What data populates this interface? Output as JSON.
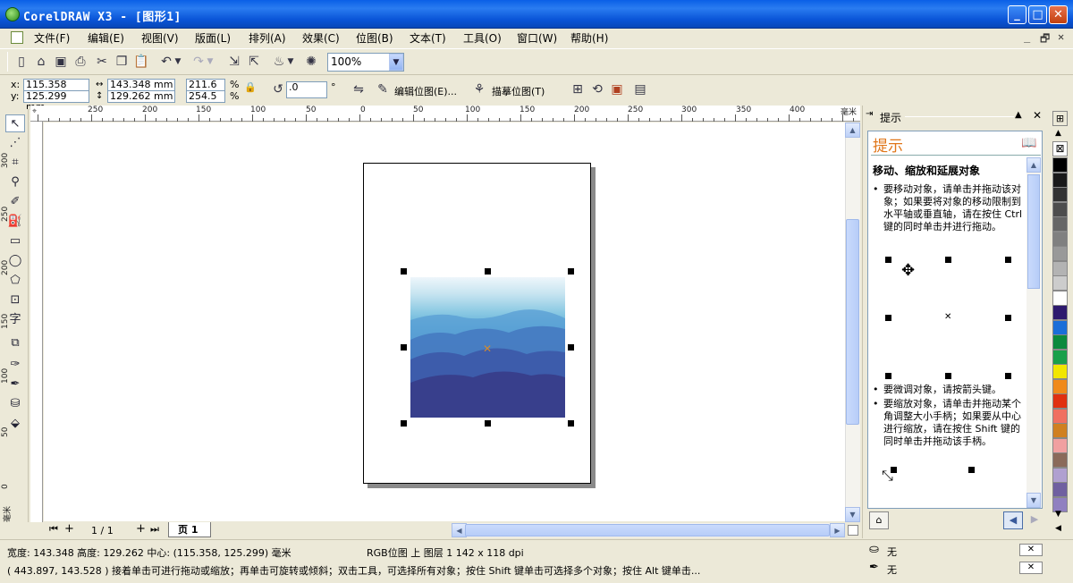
{
  "window": {
    "title": "CorelDRAW X3 - [图形1]",
    "min": "_",
    "max": "□",
    "close": "✕"
  },
  "menubar": {
    "items": [
      "文件(F)",
      "编辑(E)",
      "视图(V)",
      "版面(L)",
      "排列(A)",
      "效果(C)",
      "位图(B)",
      "文本(T)",
      "工具(O)",
      "窗口(W)",
      "帮助(H)"
    ],
    "mdi": [
      "_",
      "🗗",
      "✕"
    ]
  },
  "toolbar": {
    "zoom": "100%"
  },
  "propbar": {
    "x": "115.358 mm",
    "y": "125.299 mm",
    "w": "143.348 mm",
    "h": "129.262 mm",
    "sx": "211.6",
    "sy": "254.5",
    "pct": "%",
    "angle": ".0",
    "deg": "°",
    "edit_bitmap": "编辑位图(E)...",
    "trace_bitmap": "描摹位图(T)"
  },
  "ruler": {
    "h_labels": [
      "250",
      "200",
      "150",
      "100",
      "50",
      "0",
      "50",
      "100",
      "150",
      "200",
      "250",
      "300",
      "350",
      "400",
      "毫米"
    ],
    "v_labels": [
      "300",
      "250",
      "200",
      "150",
      "100",
      "50",
      "0",
      "毫米"
    ]
  },
  "pagebar": {
    "count": "1 / 1",
    "tab": "页 1"
  },
  "docker": {
    "header": "提示",
    "title": "提示",
    "heading": "移动、缩放和延展对象",
    "p1": "要移动对象，请单击并拖动该对象；如果要将对象的移动限制到水平轴或垂直轴，请在按住 Ctrl 键的同时单击并进行拖动。",
    "p2": "要微调对象，请按箭头键。",
    "p3": "要缩放对象，请单击并拖动某个角调整大小手柄；如果要从中心进行缩放，请在按住 Shift 键的同时单击并拖动该手柄。"
  },
  "palette": {
    "colors": [
      "#000000",
      "#1a1a1a",
      "#333333",
      "#4d4d4d",
      "#666666",
      "#808080",
      "#999999",
      "#b3b3b3",
      "#cccccc",
      "#ffffff",
      "#2e1a6e",
      "#1a6ed8",
      "#0b8a3c",
      "#1aa04a",
      "#f2e600",
      "#f08a1a",
      "#e03010",
      "#f07060",
      "#d08020",
      "#f0a0a0",
      "#8a6a5a",
      "#b0a0d0",
      "#7060a0",
      "#9080c0"
    ]
  },
  "status": {
    "line1_left": "宽度: 143.348 高度: 129.262 中心: (115.358, 125.299) 毫米",
    "line1_mid": "RGB位图 上 图层 1 142 x 118 dpi",
    "fill": "无",
    "outline": "无",
    "line2": "( 443.897, 143.528 )    接着单击可进行拖动或缩放；再单击可旋转或倾斜；双击工具，可选择所有对象；按住 Shift 键单击可选择多个对象；按住 Alt 键单击..."
  }
}
